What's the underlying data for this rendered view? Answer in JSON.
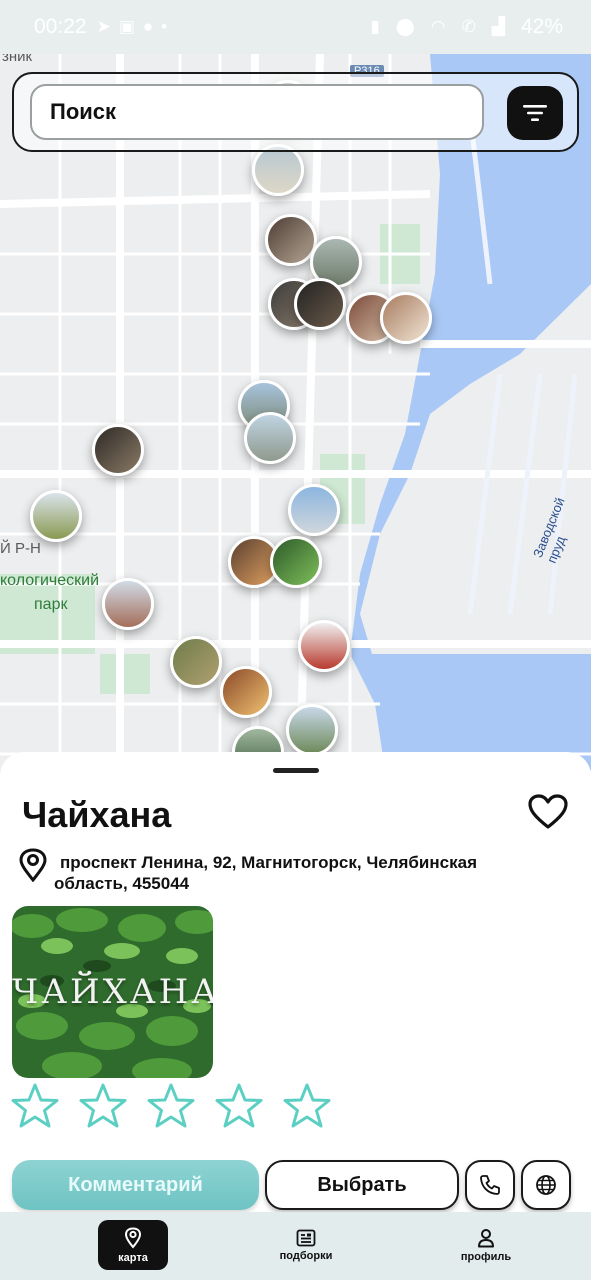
{
  "status_bar": {
    "time": "00:22",
    "battery": "42%"
  },
  "map": {
    "labels": {
      "top_left": "зник",
      "district": "Й Р-Н",
      "park_line1": "кологический",
      "park_line2": "парк",
      "pond": "Заводской пруд",
      "road": "Р316"
    }
  },
  "search": {
    "placeholder": "Поиск"
  },
  "place": {
    "title": "Чайхана",
    "address": "проспект Ленина, 92, Магнитогорск, Челябинская область, 455044",
    "photo_text": "ЧАЙХАНА",
    "rating": 0,
    "rating_max": 5
  },
  "actions": {
    "comment_label": "Комментарий",
    "select_label": "Выбрать"
  },
  "nav": {
    "items": [
      {
        "label": "карта",
        "icon": "map-pin-icon",
        "active": true
      },
      {
        "label": "подборки",
        "icon": "collections-icon",
        "active": false
      },
      {
        "label": "профиль",
        "icon": "user-icon",
        "active": false
      }
    ]
  },
  "colors": {
    "accent": "#6ec3c3",
    "water": "#a9c8f5",
    "park": "#cfe8d3"
  }
}
